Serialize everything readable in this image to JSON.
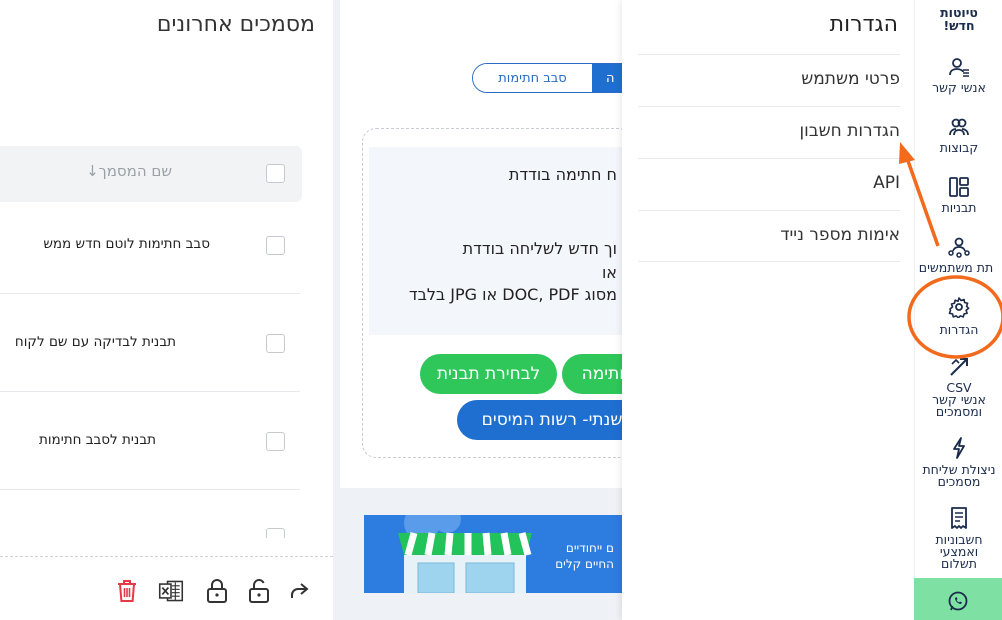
{
  "recent_docs": {
    "title": "מסמכים אחרונים",
    "header_label": "שם המסמך↓",
    "rows": [
      {
        "name": "סבב חתימות לוטם חדש ממש"
      },
      {
        "name": "תבנית לבדיקה עם שם לקוח"
      },
      {
        "name": "תבנית לסבב חתימות"
      }
    ],
    "toolbar_icons": [
      "share-icon",
      "unlock-icon",
      "lock-icon",
      "excel-icon",
      "trash-icon"
    ]
  },
  "send": {
    "toggle_active": "ה",
    "toggle_inactive": "סבב חתימות",
    "heading": "ח חתימה בודדת",
    "line1": "וך חדש לשליחה בודדת",
    "line2": "או",
    "line3": "מסוג DOC, PDF או JPG בלבד",
    "button_signature": "חתימה",
    "button_template": "לבחירת תבנית",
    "button_tax": "שנתי- רשות המיסים",
    "banner_line1": "ם ייחודיים",
    "banner_line2": "החיים קלים"
  },
  "settings_menu": {
    "title": "הגדרות",
    "items": [
      {
        "label": "פרטי משתמש"
      },
      {
        "label": "הגדרות חשבון"
      },
      {
        "label": "API"
      },
      {
        "label": "אימות מספר נייד"
      }
    ]
  },
  "sidebar": {
    "new_drafts": "טיוטות חדש!",
    "items": [
      {
        "label": "אנשי קשר",
        "icon": "contacts-icon"
      },
      {
        "label": "קבוצות",
        "icon": "groups-icon"
      },
      {
        "label": "תבניות",
        "icon": "templates-icon"
      },
      {
        "label": "תת משתמשים",
        "icon": "sub-users-icon"
      },
      {
        "label": "הגדרות",
        "icon": "settings-icon"
      },
      {
        "label": "CSV",
        "icon": "csv-icon"
      },
      {
        "label": "ניצולת שליחת מסמכים",
        "icon": "usage-icon"
      },
      {
        "label": "חשבוניות ואמצעי תשלום",
        "icon": "invoice-icon"
      }
    ],
    "csv_sub_1": "אנשי קשר",
    "csv_sub_2": "ומסמכים",
    "usage_line_1": "ניצולת שליחת",
    "usage_line_2": "מסמכים",
    "invoice_line_1": "חשבוניות",
    "invoice_line_2": "ואמצעי",
    "invoice_line_3": "תשלום"
  },
  "colors": {
    "primary_blue": "#1f6fd1",
    "green": "#2fc75a",
    "annotation_orange": "#f26a1b",
    "nav_text": "#1a2b4c"
  }
}
